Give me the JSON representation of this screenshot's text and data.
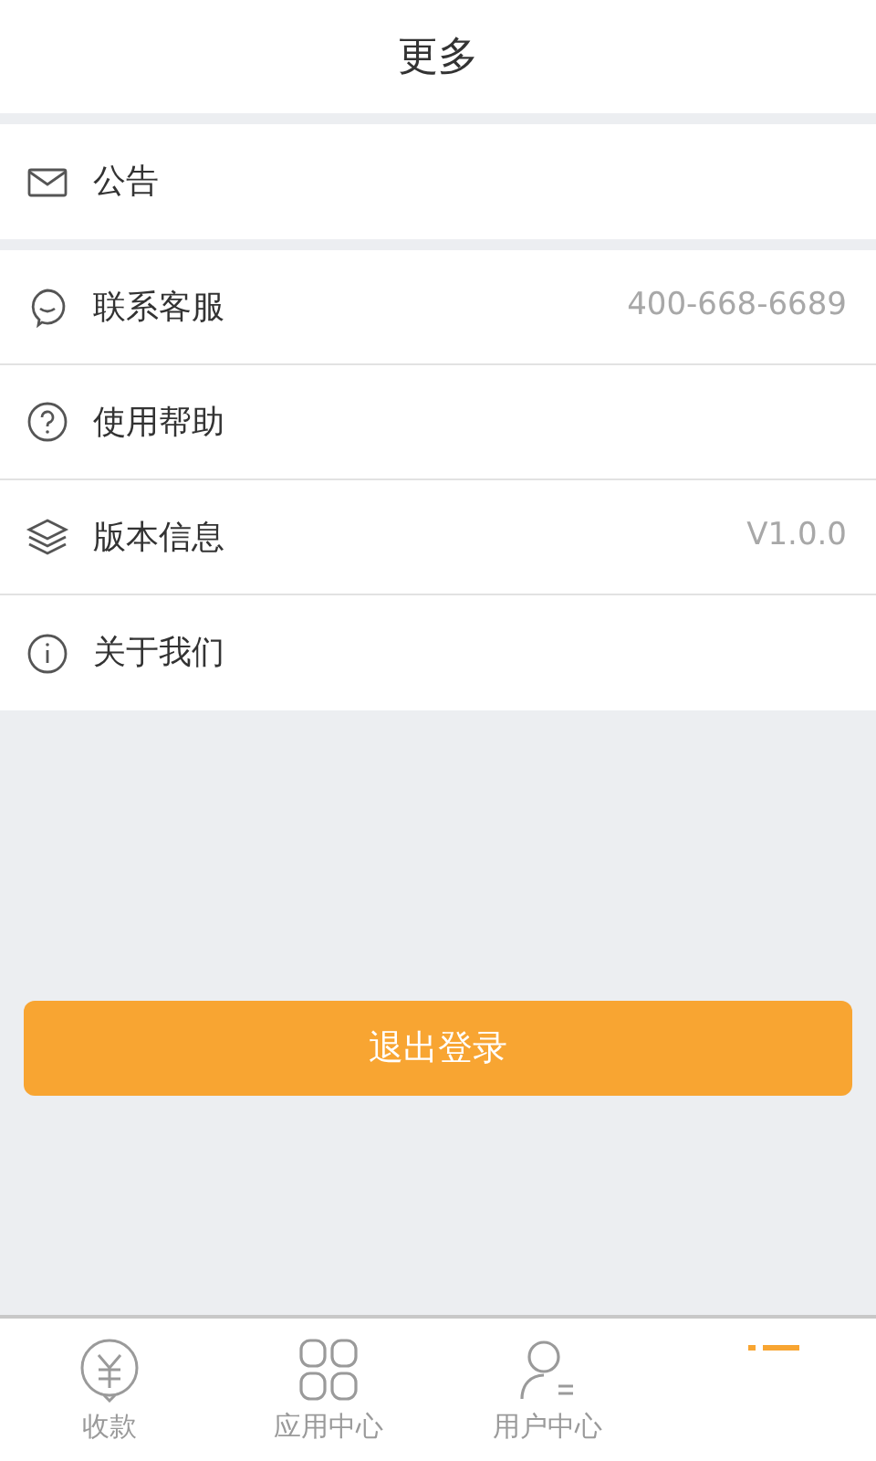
{
  "header": {
    "title": "更多"
  },
  "groups": [
    {
      "items": [
        {
          "label": "公告"
        }
      ]
    },
    {
      "items": [
        {
          "label": "联系客服",
          "value": "400-668-6689"
        },
        {
          "label": "使用帮助"
        },
        {
          "label": "版本信息",
          "value": "V1.0.0"
        },
        {
          "label": "关于我们"
        }
      ]
    }
  ],
  "logout_button": "退出登录",
  "tab_bar": [
    {
      "label": "收款",
      "selected": false
    },
    {
      "label": "应用中心",
      "selected": false
    },
    {
      "label": "用户中心",
      "selected": false
    },
    {
      "selected": true
    }
  ]
}
